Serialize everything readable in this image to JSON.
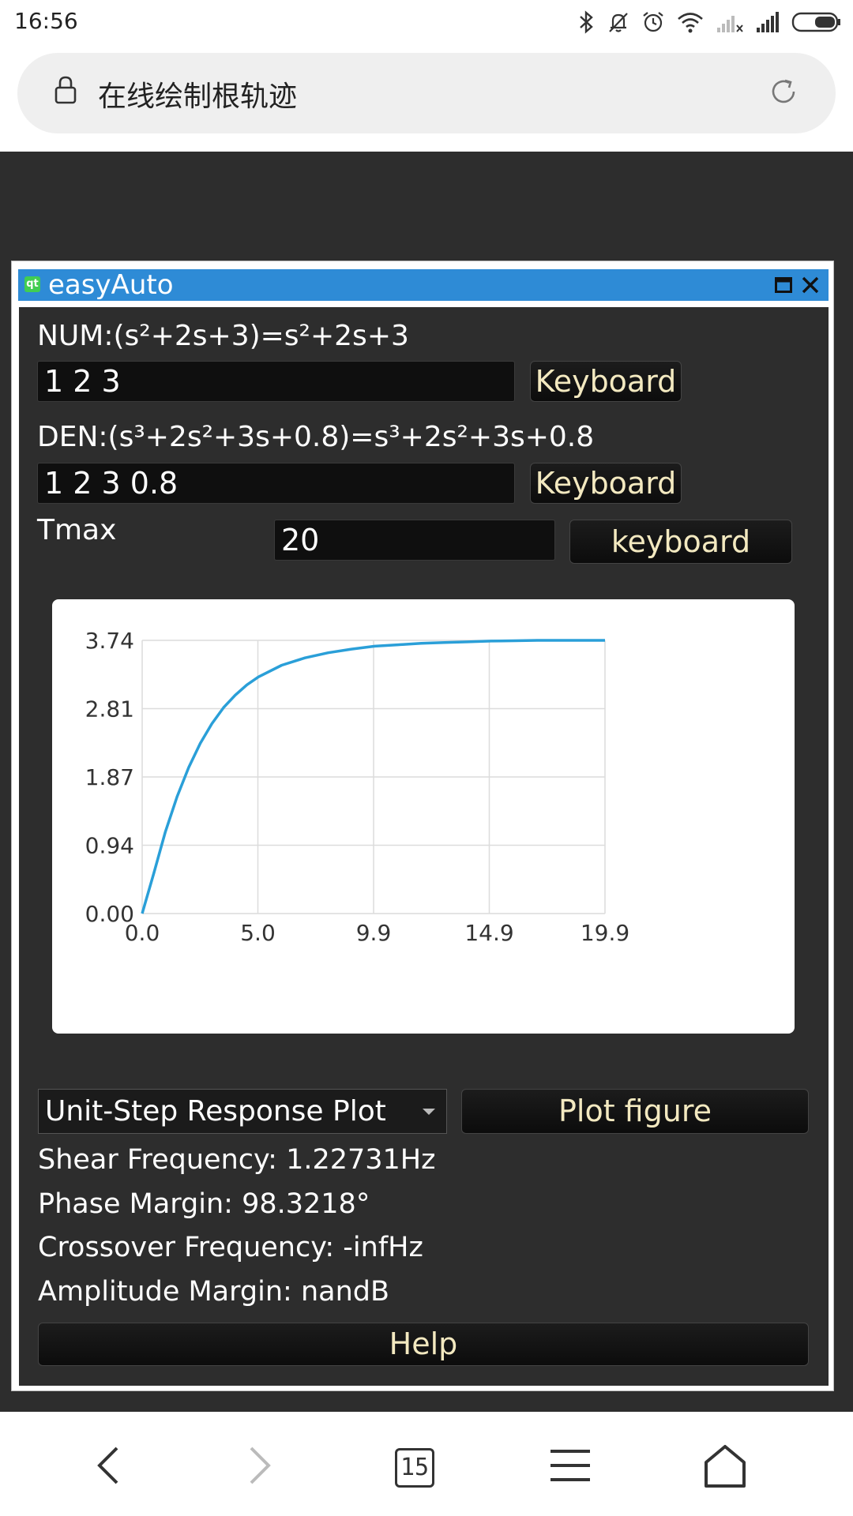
{
  "status_bar": {
    "time": "16:56",
    "icons": [
      "bluetooth-icon",
      "mute-bell-icon",
      "alarm-icon",
      "wifi-icon",
      "signal-no-sim-icon",
      "signal-icon",
      "battery-icon"
    ]
  },
  "browser": {
    "page_title": "在线绘制根轨迹",
    "tab_count": "15"
  },
  "window": {
    "title": "easyAuto",
    "title_bar_color": "#2e8bd6"
  },
  "form": {
    "num_label": "NUM:(s²+2s+3)=s²+2s+3",
    "num_value": "1 2 3",
    "num_keyboard": "Keyboard",
    "den_label": "DEN:(s³+2s²+3s+0.8)=s³+2s²+3s+0.8",
    "den_value": "1 2 3 0.8",
    "den_keyboard": "Keyboard",
    "tmax_label": "Tmax",
    "tmax_value": "20",
    "tmax_keyboard": "keyboard"
  },
  "chart_data": {
    "type": "line",
    "title": "",
    "xlabel": "",
    "ylabel": "",
    "xlim": [
      0,
      19.9
    ],
    "ylim": [
      0,
      3.74
    ],
    "x_ticks": [
      "0.0",
      "5.0",
      "9.9",
      "14.9",
      "19.9"
    ],
    "y_ticks": [
      "0.00",
      "0.94",
      "1.87",
      "2.81",
      "3.74"
    ],
    "grid": true,
    "line_color": "#2a9fd8",
    "series": [
      {
        "x": [
          0,
          0.5,
          1,
          1.5,
          2,
          2.5,
          3,
          3.5,
          4,
          4.5,
          5,
          6,
          7,
          8,
          9,
          10,
          11,
          12,
          13,
          14,
          15,
          16,
          17,
          18,
          19,
          19.9
        ],
        "values": [
          0.0,
          0.55,
          1.12,
          1.6,
          2.0,
          2.33,
          2.6,
          2.82,
          2.99,
          3.13,
          3.24,
          3.4,
          3.5,
          3.57,
          3.62,
          3.66,
          3.68,
          3.7,
          3.71,
          3.72,
          3.73,
          3.735,
          3.74,
          3.74,
          3.74,
          3.74
        ]
      }
    ]
  },
  "controls": {
    "plot_type": "Unit-Step Response Plot",
    "plot_button": "Plot figure"
  },
  "results": {
    "shear_frequency": "Shear Frequency: 1.22731Hz",
    "phase_margin": "Phase Margin: 98.3218°",
    "crossover_frequency": "Crossover Frequency: -infHz",
    "amplitude_margin": "Amplitude Margin: nandB"
  },
  "help_button": "Help"
}
